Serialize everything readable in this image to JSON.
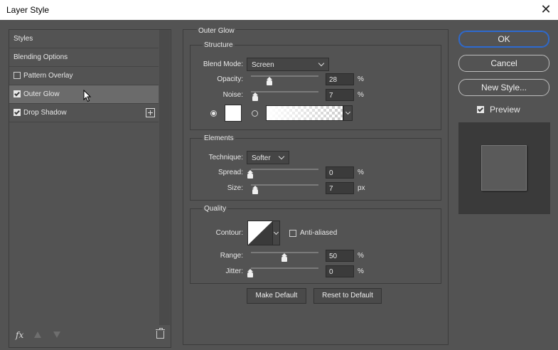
{
  "window": {
    "title": "Layer Style",
    "close_glyph": "✕"
  },
  "sidebar": {
    "items": [
      {
        "label": "Styles",
        "checkbox": null,
        "selected": false
      },
      {
        "label": "Blending Options",
        "checkbox": null,
        "selected": false
      },
      {
        "label": "Pattern Overlay",
        "checkbox": false,
        "selected": false
      },
      {
        "label": "Outer Glow",
        "checkbox": true,
        "selected": true
      },
      {
        "label": "Drop Shadow",
        "checkbox": true,
        "selected": false
      }
    ],
    "footer": {
      "fx_label": "fx"
    }
  },
  "panel": {
    "title": "Outer Glow",
    "structure": {
      "title": "Structure",
      "blend_mode_label": "Blend Mode:",
      "blend_mode_value": "Screen",
      "opacity_label": "Opacity:",
      "opacity_value": "28",
      "opacity_unit": "%",
      "noise_label": "Noise:",
      "noise_value": "7",
      "noise_unit": "%",
      "color_mode": "solid",
      "color": "#ffffff"
    },
    "elements": {
      "title": "Elements",
      "technique_label": "Technique:",
      "technique_value": "Softer",
      "spread_label": "Spread:",
      "spread_value": "0",
      "spread_unit": "%",
      "size_label": "Size:",
      "size_value": "7",
      "size_unit": "px"
    },
    "quality": {
      "title": "Quality",
      "contour_label": "Contour:",
      "anti_aliased_label": "Anti-aliased",
      "anti_aliased": false,
      "range_label": "Range:",
      "range_value": "50",
      "range_unit": "%",
      "jitter_label": "Jitter:",
      "jitter_value": "0",
      "jitter_unit": "%"
    },
    "make_default_label": "Make Default",
    "reset_default_label": "Reset to Default"
  },
  "actions": {
    "ok_label": "OK",
    "cancel_label": "Cancel",
    "new_style_label": "New Style...",
    "preview_label": "Preview",
    "preview_checked": true
  }
}
